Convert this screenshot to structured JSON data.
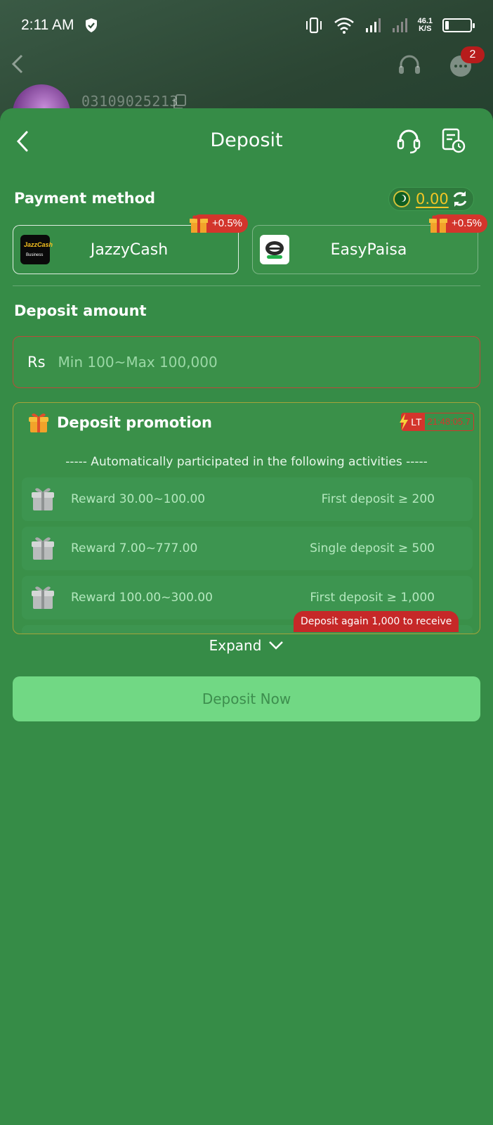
{
  "status_bar": {
    "time": "2:11 AM",
    "net_speed_value": "46.1",
    "net_speed_unit": "K/S"
  },
  "background": {
    "phone_number": "03109025213",
    "notification_count": "2"
  },
  "header": {
    "title": "Deposit"
  },
  "payment": {
    "label": "Payment method",
    "balance": "0.00",
    "methods": [
      {
        "name": "JazzyCash",
        "logo_text": "JazzCash",
        "logo_sub": "Business",
        "bonus": "+0.5%",
        "selected": true
      },
      {
        "name": "EasyPaisa",
        "bonus": "+0.5%",
        "selected": false
      }
    ]
  },
  "amount": {
    "label": "Deposit amount",
    "currency": "Rs",
    "placeholder": "Min 100~Max 100,000",
    "value": ""
  },
  "promotion": {
    "title": "Deposit promotion",
    "lt_label": "LT",
    "timer": "21:48:05.7",
    "subtitle": "----- Automatically participated in the following activities -----",
    "rewards": [
      {
        "label": "Reward  30.00~100.00",
        "condition": "First deposit ≥ 200"
      },
      {
        "label": "Reward  7.00~777.00",
        "condition": "Single deposit ≥ 500"
      },
      {
        "label": "Reward  100.00~300.00",
        "condition": "First deposit ≥ 1,000"
      }
    ],
    "deposit_again": "Deposit again 1,000 to receive"
  },
  "expand_label": "Expand",
  "deposit_button": "Deposit Now",
  "colors": {
    "sheet_bg": "#368c47",
    "button_bg": "#71d884",
    "bonus_red": "#d3352c",
    "balance_yellow": "#f3c625"
  },
  "icons": [
    "back-icon",
    "headset-icon",
    "history-icon",
    "refresh-icon",
    "gift-icon",
    "bolt-icon",
    "chevron-down-icon",
    "copy-icon",
    "chat-icon",
    "shield-icon"
  ]
}
